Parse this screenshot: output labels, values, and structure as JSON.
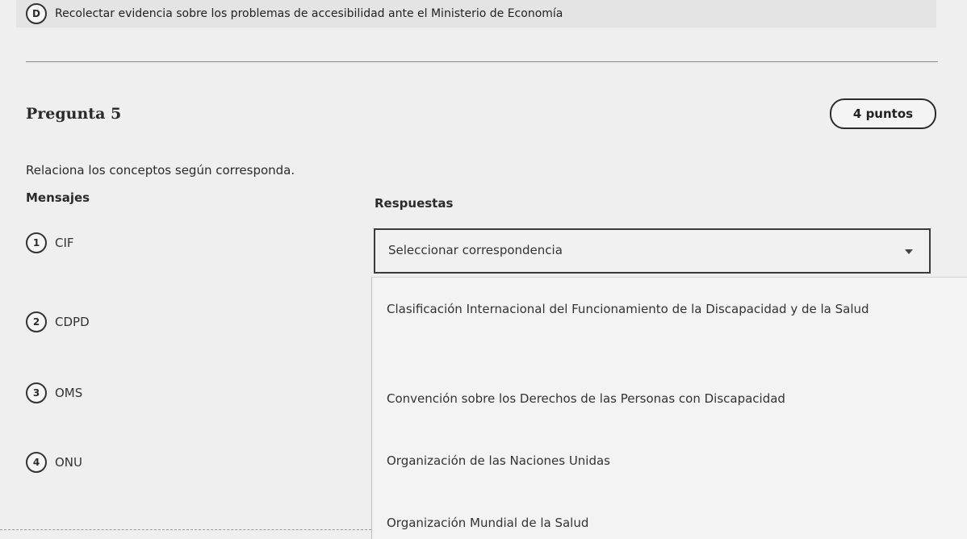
{
  "previous_option": {
    "letter": "D",
    "text": "Recolectar evidencia sobre los problemas de accesibilidad ante el Ministerio de Economía"
  },
  "question": {
    "title": "Pregunta 5",
    "points": "4 puntos",
    "instructions": "Relaciona los conceptos según corresponda.",
    "left_header": "Mensajes",
    "right_header": "Respuestas"
  },
  "messages": [
    {
      "number": "1",
      "label": "CIF"
    },
    {
      "number": "2",
      "label": "CDPD"
    },
    {
      "number": "3",
      "label": "OMS"
    },
    {
      "number": "4",
      "label": "ONU"
    }
  ],
  "select": {
    "value": "Seleccionar correspondencia",
    "expanded": true
  },
  "options": [
    "Clasificación Internacional del Funcionamiento de la Discapacidad y de la Salud",
    "Convención sobre los Derechos de las Personas con Discapacidad",
    "Organización de las Naciones Unidas",
    "Organización Mundial de la Salud"
  ]
}
